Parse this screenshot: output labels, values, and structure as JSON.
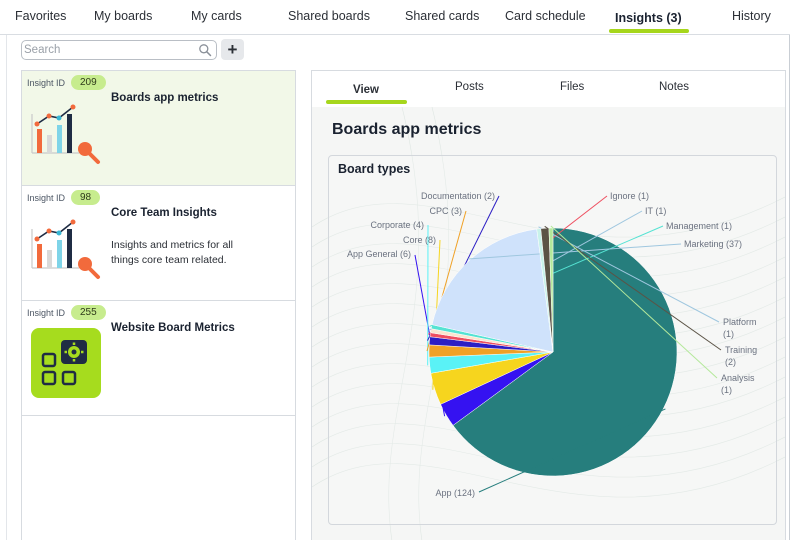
{
  "nav": {
    "tabs": [
      {
        "label": "Favorites"
      },
      {
        "label": "My boards"
      },
      {
        "label": "My cards"
      },
      {
        "label": "Shared boards"
      },
      {
        "label": "Shared cards"
      },
      {
        "label": "Card schedule"
      },
      {
        "label": "Insights (3)"
      },
      {
        "label": "History"
      }
    ],
    "active_index": 6
  },
  "search": {
    "placeholder": "Search",
    "value": "",
    "add_label": "+"
  },
  "insights": [
    {
      "id_label": "Insight ID",
      "id": "209",
      "title": "Boards app metrics",
      "description": "",
      "icon": "chart-magnifier-icon",
      "selected": true
    },
    {
      "id_label": "Insight ID",
      "id": "98",
      "title": "Core Team Insights",
      "description": "Insights and metrics for all things core team related.",
      "icon": "chart-magnifier-icon",
      "selected": false
    },
    {
      "id_label": "Insight ID",
      "id": "255",
      "title": "Website Board Metrics",
      "description": "",
      "icon": "board-gear-icon",
      "selected": false
    }
  ],
  "detail": {
    "tabs": [
      {
        "label": "View"
      },
      {
        "label": "Posts"
      },
      {
        "label": "Files"
      },
      {
        "label": "Notes"
      }
    ],
    "active_tab": 0,
    "title": "Boards app metrics",
    "widget_title": "Board types"
  },
  "colors": {
    "accent": "#a6d61c",
    "selected_card": "#f2f8e8",
    "badge": "#c7ec8e"
  },
  "chart_data": {
    "type": "pie",
    "title": "Board types",
    "series": [
      {
        "name": "Board types",
        "slices": [
          {
            "label": "App",
            "value": 124,
            "color": "#267e7d"
          },
          {
            "label": "App General",
            "value": 6,
            "color": "#3512f1"
          },
          {
            "label": "Core",
            "value": 8,
            "color": "#f6d51e"
          },
          {
            "label": "Corporate",
            "value": 4,
            "color": "#5af2f6"
          },
          {
            "label": "CPC",
            "value": 3,
            "color": "#f0a126"
          },
          {
            "label": "Documentation",
            "value": 2,
            "color": "#2c1ec4"
          },
          {
            "label": "Ignore",
            "value": 1,
            "color": "#ee4f60"
          },
          {
            "label": "IT",
            "value": 1,
            "color": "#fbe6cf"
          },
          {
            "label": "Management",
            "value": 1,
            "color": "#55e3d3"
          },
          {
            "label": "Marketing",
            "value": 37,
            "color": "#cfe2fb"
          },
          {
            "label": "Platform",
            "value": 1,
            "color": "#c8f2ea"
          },
          {
            "label": "Training",
            "value": 2,
            "color": "#5b5346"
          },
          {
            "label": "Analysis",
            "value": 1,
            "color": "#b4e89b"
          }
        ]
      }
    ],
    "label_format": "{label} ({value})",
    "legend": "none"
  }
}
